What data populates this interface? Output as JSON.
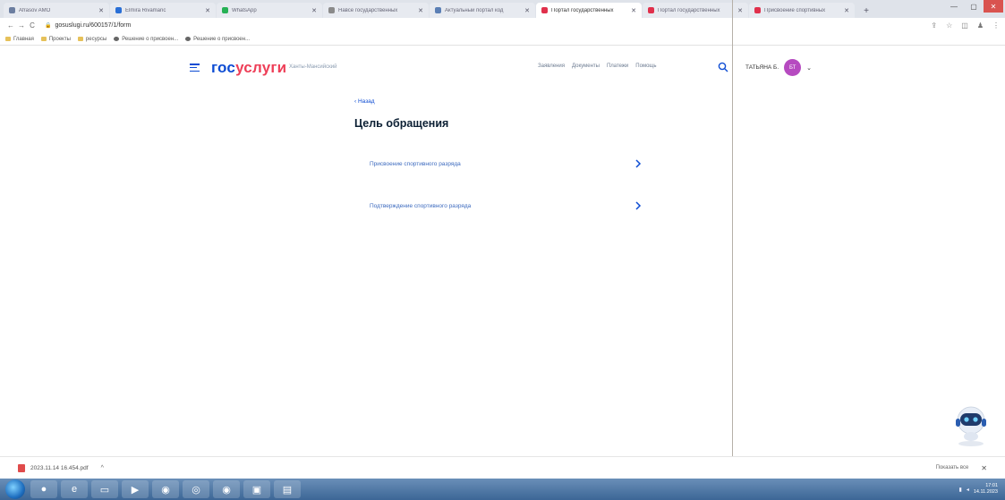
{
  "browser": {
    "tabs": [
      {
        "label": "Afrasov AMO",
        "color": "#6c7ea0",
        "active": false
      },
      {
        "label": "Elmira Rivamanc",
        "color": "#2a6fd6",
        "active": false
      },
      {
        "label": "WhatsApp",
        "color": "#27b155",
        "active": false
      },
      {
        "label": "Навсе государственных",
        "color": "#8a8a8a",
        "active": false
      },
      {
        "label": "Актуальный портал код",
        "color": "#5b7fb5",
        "active": false
      },
      {
        "label": "Портал государственных",
        "color": "#e0304c",
        "active": true
      },
      {
        "label": "Портал государственных",
        "color": "#e0304c",
        "active": false
      },
      {
        "label": "Присвоение спортивных",
        "color": "#e0304c",
        "active": false
      }
    ],
    "new_tab": "+",
    "url": "gosuslugi.ru/600157/1/form",
    "bookmarks": [
      {
        "label": "Главная",
        "icon": "folder-icon"
      },
      {
        "label": "Проекты",
        "icon": "folder-icon"
      },
      {
        "label": "ресурсы",
        "icon": "folder-icon"
      },
      {
        "label": "Решение о присвоен...",
        "icon": "globe-icon"
      },
      {
        "label": "Решение о присвоен...",
        "icon": "globe-icon"
      }
    ]
  },
  "header": {
    "logo_part1": "гос",
    "logo_part2": "услуги",
    "region": "Ханты-Мансийский",
    "nav": [
      "Заявления",
      "Документы",
      "Платежи",
      "Помощь"
    ],
    "user_name": "ТАТЬЯНА Б.",
    "avatar_initials": "БТ"
  },
  "main": {
    "back": "‹ Назад",
    "title": "Цель обращения",
    "options": [
      {
        "label": "Присвоение спортивного разряда"
      },
      {
        "label": "Подтверждение спортивного разряда"
      }
    ]
  },
  "downloads": {
    "file": "2023.11.14 16.454.pdf",
    "show_all": "Показать все"
  },
  "taskbar": {
    "time": "17:01",
    "date": "14.11.2023"
  },
  "colors": {
    "brand_blue": "#0d4cd3",
    "brand_red": "#ee3f58",
    "link": "#3d6bbf",
    "avatar": "#b64ac0"
  }
}
